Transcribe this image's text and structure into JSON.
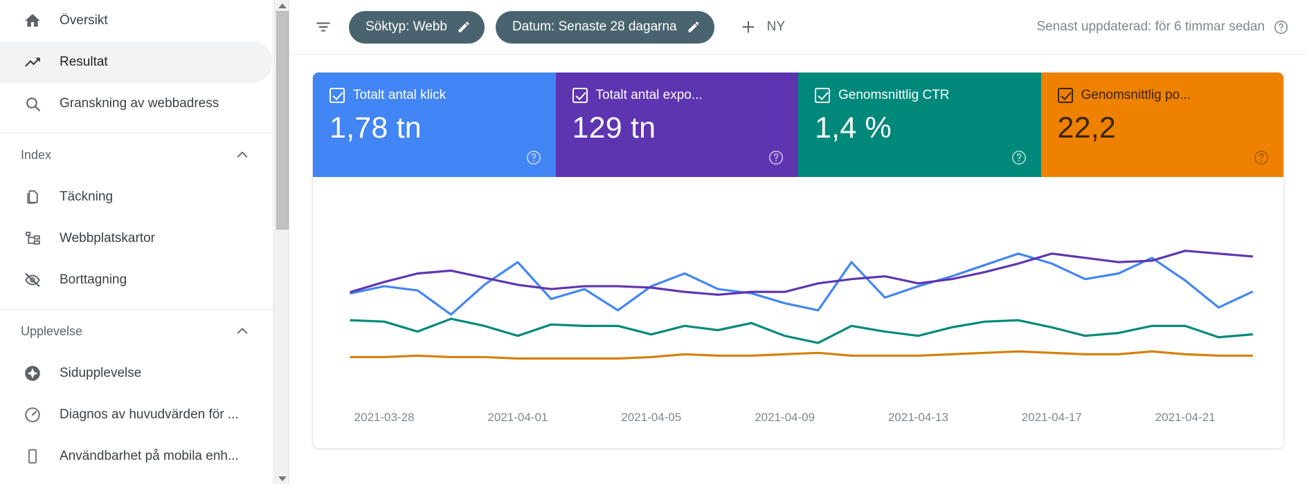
{
  "sidebar": {
    "items": [
      {
        "label": "Översikt",
        "icon": "home-icon",
        "active": false
      },
      {
        "label": "Resultat",
        "icon": "trending-up-icon",
        "active": true
      },
      {
        "label": "Granskning av webbadress",
        "icon": "search-icon",
        "active": false
      }
    ],
    "sections": [
      {
        "title": "Index",
        "collapse_icon": "chevron-up-icon",
        "items": [
          {
            "label": "Täckning",
            "icon": "documents-icon"
          },
          {
            "label": "Webbplatskartor",
            "icon": "sitemap-icon"
          },
          {
            "label": "Borttagning",
            "icon": "eye-off-icon"
          }
        ]
      },
      {
        "title": "Upplevelse",
        "collapse_icon": "chevron-up-icon",
        "items": [
          {
            "label": "Sidupplevelse",
            "icon": "page-experience-icon"
          },
          {
            "label": "Diagnos av huvudvärden för ...",
            "icon": "speedometer-icon"
          },
          {
            "label": "Användbarhet på mobila enh...",
            "icon": "mobile-icon"
          }
        ]
      }
    ],
    "scrollbar": {
      "up_arrow": "triangle-up-icon",
      "down_arrow": "triangle-down-icon"
    }
  },
  "toolbar": {
    "filter_icon": "filter-icon",
    "chips": [
      {
        "label": "Söktyp: Webb",
        "edit_icon": "pencil-icon"
      },
      {
        "label": "Datum: Senaste 28 dagarna",
        "edit_icon": "pencil-icon"
      }
    ],
    "new_button": {
      "label": "NY",
      "icon": "plus-icon"
    },
    "updated": {
      "text": "Senast uppdaterad: för 6 timmar sedan",
      "help_icon": "help-circle-icon"
    }
  },
  "metrics": [
    {
      "name": "Totalt antal klick",
      "value": "1,78 tn",
      "color": "#4285f4",
      "text_color": "#ffffff",
      "checked": true,
      "help_icon": "help-circle-icon"
    },
    {
      "name": "Totalt antal expo...",
      "value": "129 tn",
      "color": "#5e35b1",
      "text_color": "#ffffff",
      "checked": true,
      "help_icon": "help-circle-icon"
    },
    {
      "name": "Genomsnittlig CTR",
      "value": "1,4 %",
      "color": "#00897b",
      "text_color": "#ffffff",
      "checked": true,
      "help_icon": "help-circle-icon"
    },
    {
      "name": "Genomsnittlig po...",
      "value": "22,2",
      "color": "#ef8100",
      "text_color": "#3a2400",
      "checked": true,
      "help_icon": "help-circle-icon"
    }
  ],
  "chart_data": {
    "type": "line",
    "title": "",
    "xlabel": "",
    "ylabel": "",
    "grid": false,
    "legend": "none",
    "x": [
      "2021-03-27",
      "2021-03-28",
      "2021-03-29",
      "2021-03-30",
      "2021-03-31",
      "2021-04-01",
      "2021-04-02",
      "2021-04-03",
      "2021-04-04",
      "2021-04-05",
      "2021-04-06",
      "2021-04-07",
      "2021-04-08",
      "2021-04-09",
      "2021-04-10",
      "2021-04-11",
      "2021-04-12",
      "2021-04-13",
      "2021-04-14",
      "2021-04-15",
      "2021-04-16",
      "2021-04-17",
      "2021-04-18",
      "2021-04-19",
      "2021-04-20",
      "2021-04-21",
      "2021-04-22",
      "2021-04-23"
    ],
    "tick_labels": [
      "2021-03-28",
      "2021-04-01",
      "2021-04-05",
      "2021-04-09",
      "2021-04-13",
      "2021-04-17",
      "2021-04-21"
    ],
    "tick_indices": [
      1,
      5,
      9,
      13,
      17,
      21,
      25
    ],
    "series": [
      {
        "name": "Totalt antal klick",
        "color": "#4285f4",
        "values": [
          56,
          61,
          58,
          41,
          62,
          78,
          52,
          59,
          44,
          61,
          70,
          59,
          56,
          49,
          44,
          78,
          53,
          61,
          68,
          76,
          84,
          77,
          66,
          70,
          81,
          65,
          46,
          57
        ]
      },
      {
        "name": "Totalt antal exponeringar",
        "color": "#5e35b1",
        "values": [
          57,
          64,
          70,
          72,
          67,
          62,
          59,
          61,
          61,
          60,
          57,
          55,
          57,
          57,
          63,
          66,
          68,
          63,
          66,
          71,
          77,
          84,
          81,
          78,
          79,
          86,
          84,
          82
        ]
      },
      {
        "name": "Genomsnittlig CTR",
        "color": "#00897b",
        "values": [
          37,
          36,
          29,
          38,
          33,
          26,
          34,
          33,
          33,
          27,
          33,
          30,
          35,
          26,
          21,
          33,
          29,
          26,
          32,
          36,
          37,
          32,
          26,
          28,
          33,
          33,
          25,
          27
        ]
      },
      {
        "name": "Genomsnittlig position",
        "color": "#d4810a",
        "values": [
          11,
          11,
          12,
          11,
          11,
          10,
          10,
          10,
          10,
          11,
          13,
          12,
          12,
          13,
          14,
          12,
          12,
          12,
          13,
          14,
          15,
          14,
          13,
          13,
          15,
          13,
          12,
          12
        ]
      }
    ],
    "ylim": [
      0,
      100
    ]
  }
}
